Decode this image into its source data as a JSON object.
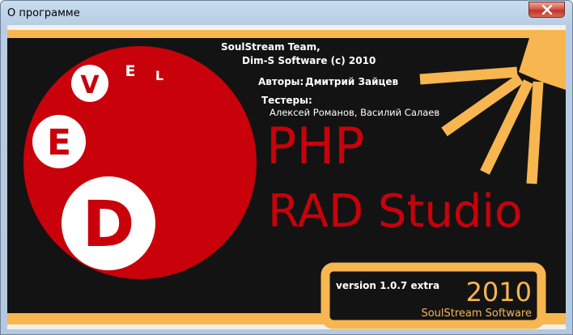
{
  "window": {
    "title": "О программе"
  },
  "about": {
    "team": "SoulStream Team,",
    "copyright": "Dim-S Software (c) 2010",
    "authors_label": "Авторы:",
    "authors": "Дмитрий Зайцев",
    "testers_label": "Тестеры:",
    "testers": "Алексей Романов, Василий Салаев",
    "product_line1": "PHP",
    "product_line2": "RAD Studio",
    "version": "version 1.0.7 extra",
    "year": "2010",
    "company": "SoulStream Software"
  },
  "logo": {
    "letters": [
      "D",
      "E",
      "V",
      "E",
      "L"
    ]
  },
  "colors": {
    "background": "#131313",
    "red": "#c8010b",
    "orange": "#f7b64f",
    "white": "#ffffff"
  }
}
